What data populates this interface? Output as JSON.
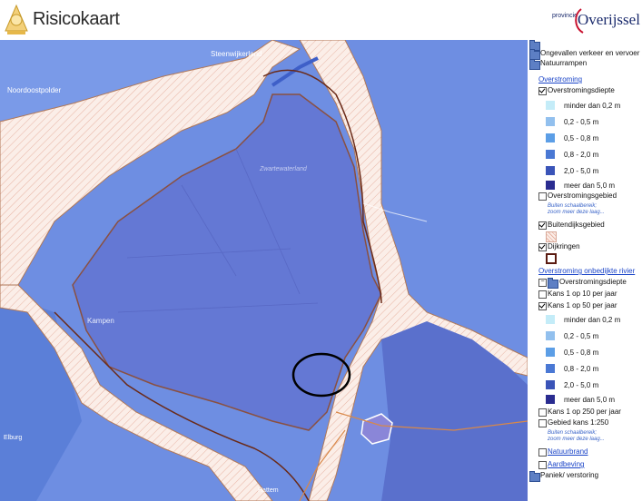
{
  "header": {
    "app_title": "Risicokaart",
    "province_small": "provincie",
    "province_name": "Overijssel"
  },
  "map": {
    "labels": {
      "steenwijkerland": "Steenwijkerland",
      "noordoostpolder": "Noordoostpolder",
      "zwartewaterland": "Zwartewaterland",
      "kampen": "Kampen",
      "elburg": "Elburg",
      "hattem": "Hattem"
    }
  },
  "legend": {
    "ongevallen": "Ongevallen verkeer en vervoer",
    "natuurrampen": "Natuurrampen",
    "overstroming": "Overstroming",
    "overstromingsdiepte": "Overstromingsdiepte",
    "depth_classes": [
      {
        "label": "minder dan 0,2 m",
        "color": "#c4ecf8"
      },
      {
        "label": "0,2 - 0,5 m",
        "color": "#92c0ee"
      },
      {
        "label": "0,5 - 0,8 m",
        "color": "#5c9ee6"
      },
      {
        "label": "0,8 - 2,0 m",
        "color": "#4a78d4"
      },
      {
        "label": "2,0 - 5,0 m",
        "color": "#3a54b8"
      },
      {
        "label": "meer dan 5,0 m",
        "color": "#2a2c90"
      }
    ],
    "overstromingsgebied": "Overstromingsgebied",
    "buiten_note_1": "Buiten schaalbereik;",
    "buiten_note_2": "zoom meer deze laag...",
    "buitendijksgebied": "Buitendijksgebied",
    "dijkringen": "Dijkringen",
    "overstroming_onbedijkte": "Overstroming onbedijkte rivier",
    "overstromingsdiepte2": "Overstromingsdiepte",
    "kans_10": "Kans 1 op 10 per jaar",
    "kans_50": "Kans 1 op 50 per jaar",
    "depth_classes2": [
      {
        "label": "minder dan 0,2 m",
        "color": "#c4ecf8"
      },
      {
        "label": "0,2 - 0,5 m",
        "color": "#92c0ee"
      },
      {
        "label": "0,5 - 0,8 m",
        "color": "#5c9ee6"
      },
      {
        "label": "0,8 - 2,0 m",
        "color": "#4a78d4"
      },
      {
        "label": "2,0 - 5,0 m",
        "color": "#3a54b8"
      },
      {
        "label": "meer dan 5,0 m",
        "color": "#2a2c90"
      }
    ],
    "kans_250": "Kans 1 op 250 per jaar",
    "gebied_kans": "Gebied kans 1:250",
    "buiten_note_3": "Buiten schaalbereik;",
    "buiten_note_4": "zoom meer deze laag...",
    "natuurbrand": "Natuurbrand",
    "aardbeving": "Aardbeving",
    "paniek": "Paniek/ verstoring"
  }
}
